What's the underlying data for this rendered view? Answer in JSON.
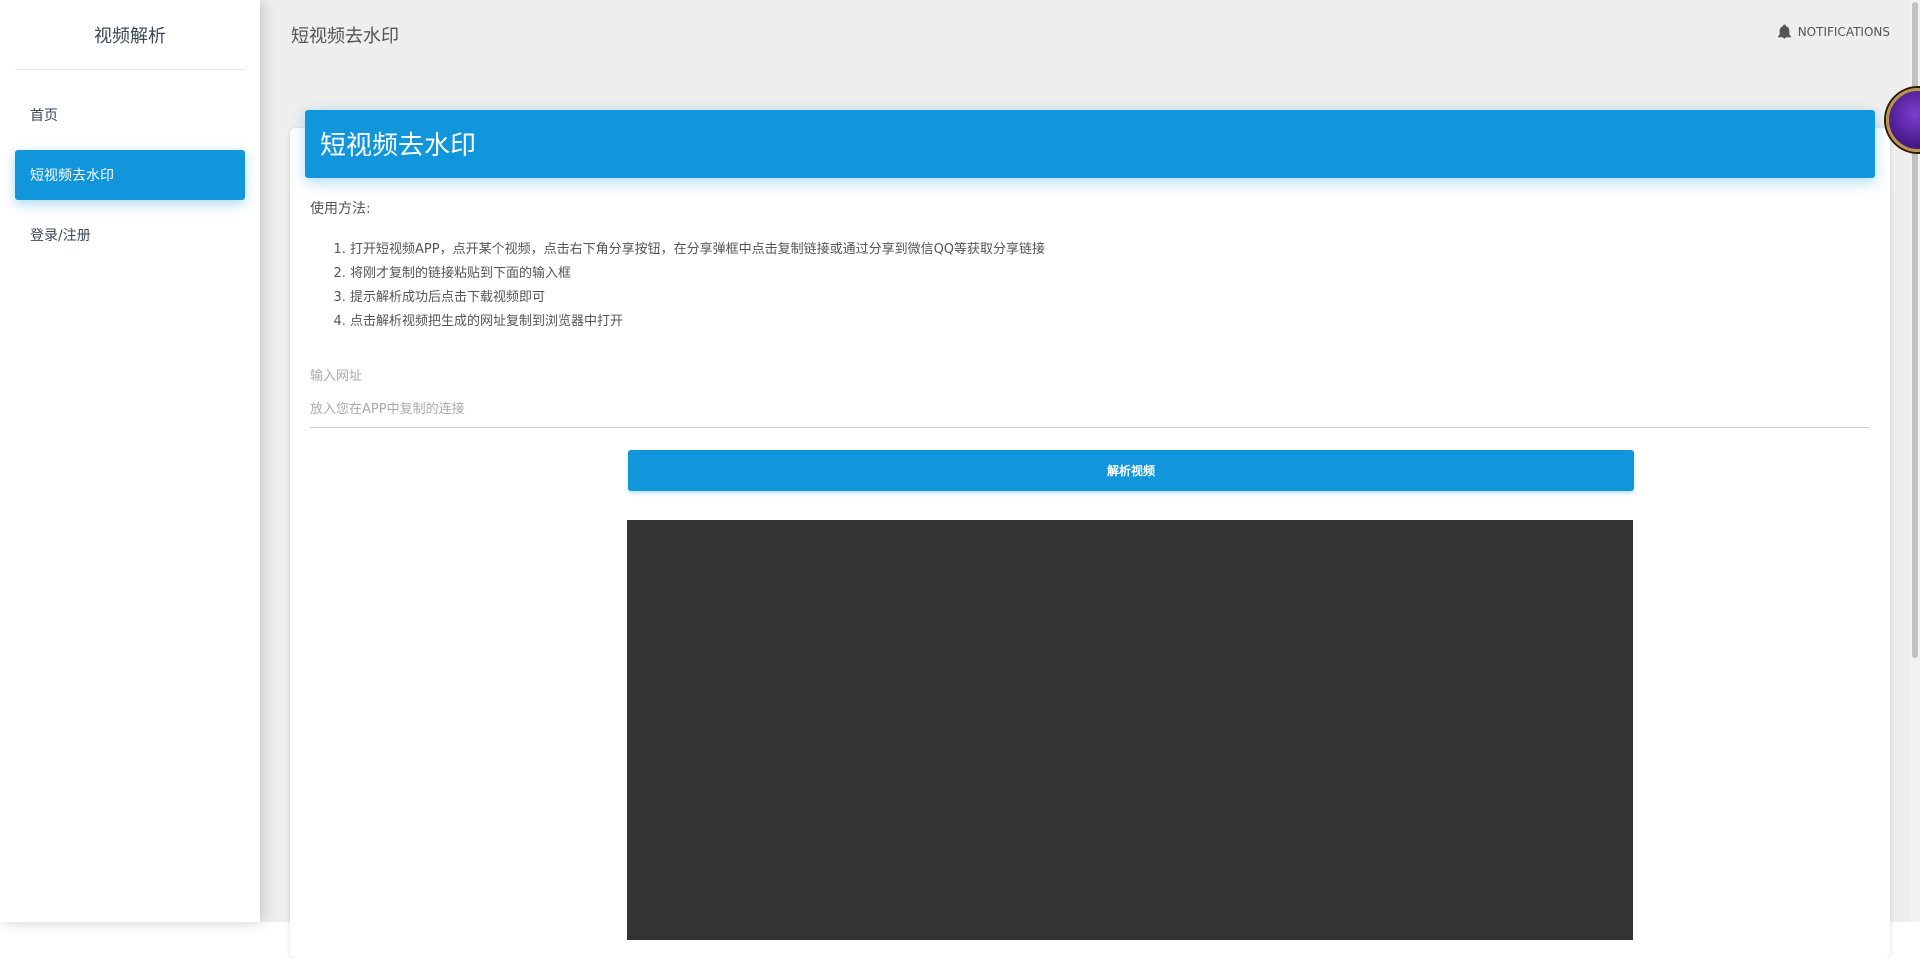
{
  "sidebar": {
    "brand": "视频解析",
    "items": [
      {
        "label": "首页",
        "active": false
      },
      {
        "label": "短视频去水印",
        "active": true
      },
      {
        "label": "登录/注册",
        "active": false
      }
    ]
  },
  "topbar": {
    "title": "短视频去水印",
    "notifications_label": "NOTIFICATIONS"
  },
  "card": {
    "title": "短视频去水印",
    "usage_title": "使用方法:",
    "steps": [
      "打开短视频APP，点开某个视频，点击右下角分享按钮，在分享弹框中点击复制链接或通过分享到微信QQ等获取分享链接",
      "将刚才复制的链接粘贴到下面的输入框",
      "提示解析成功后点击下载视频即可",
      "点击解析视频把生成的网址复制到浏览器中打开"
    ],
    "input_label": "输入网址",
    "input_placeholder": "放入您在APP中复制的连接",
    "input_value": "",
    "parse_button_label": "解析视频"
  },
  "colors": {
    "accent": "#1196db",
    "background": "#eeeeee",
    "video_bg": "#333333"
  },
  "icons": {
    "notifications": "bell-icon"
  }
}
